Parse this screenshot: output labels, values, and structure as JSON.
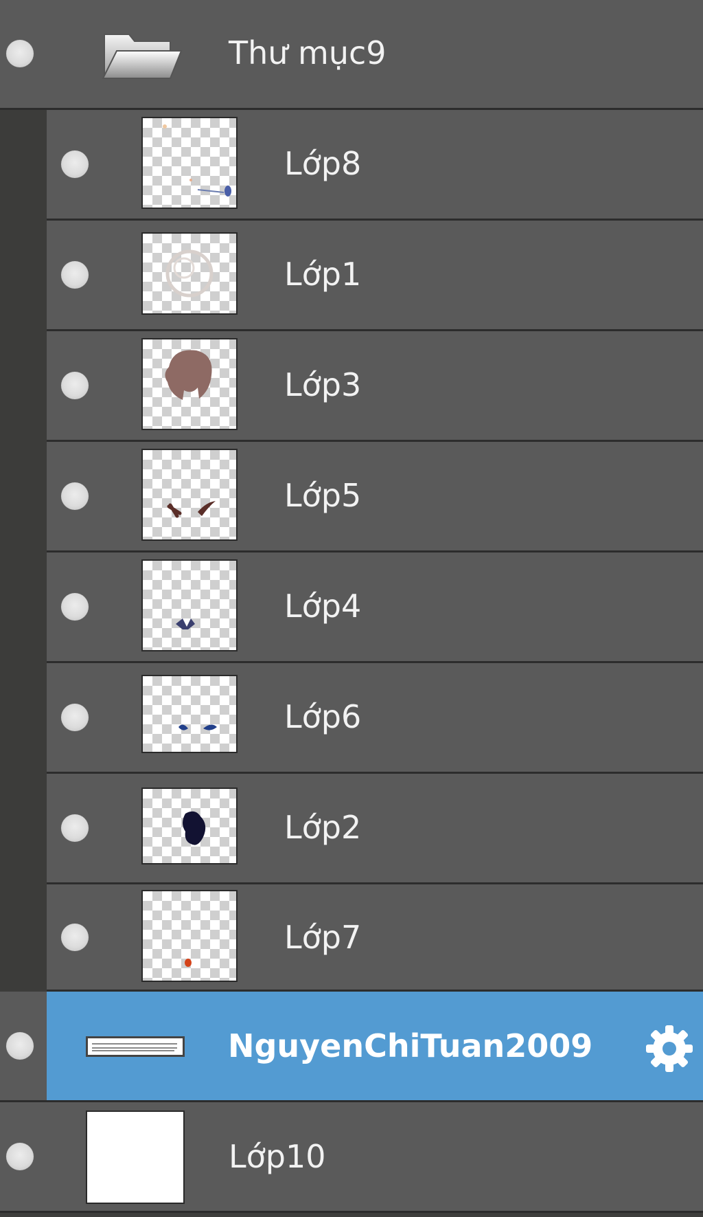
{
  "layers_panel": {
    "folder": {
      "name": "Thư mục9",
      "icon": "folder-icon"
    },
    "child_layers": [
      {
        "name": "Lớp8"
      },
      {
        "name": "Lớp1"
      },
      {
        "name": "Lớp3"
      },
      {
        "name": "Lớp5"
      },
      {
        "name": "Lớp4"
      },
      {
        "name": "Lớp6"
      },
      {
        "name": "Lớp2"
      },
      {
        "name": "Lớp7"
      }
    ],
    "selected_layer": {
      "name": "NguyenChiTuan2009",
      "settings_icon": "gear-icon"
    },
    "bottom_layer": {
      "name": "Lớp10"
    },
    "colors": {
      "row_bg": "#5a5a5a",
      "selected_bg": "#539bd2",
      "panel_bg": "#3e3e3c"
    }
  }
}
